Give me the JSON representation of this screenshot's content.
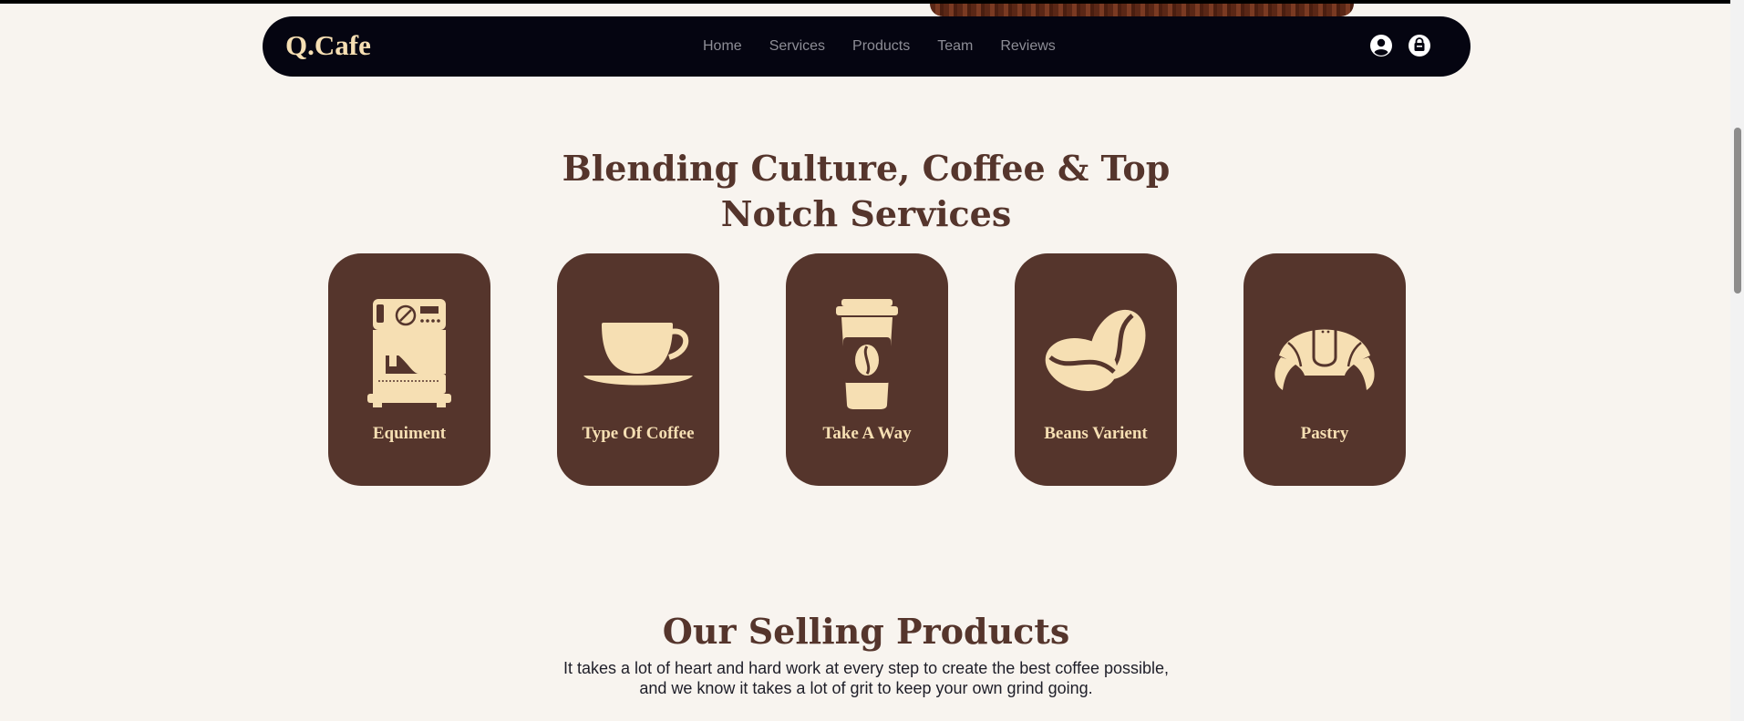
{
  "header": {
    "logo": "Q.Cafe",
    "nav": [
      "Home",
      "Services",
      "Products",
      "Team",
      "Reviews"
    ],
    "icons": [
      "user-icon",
      "shopping-bag-icon"
    ]
  },
  "services": {
    "title_line1": "Blending Culture, Coffee & Top",
    "title_line2": "Notch Services",
    "cards": [
      {
        "label": "Equiment",
        "icon": "espresso-machine-icon"
      },
      {
        "label": "Type Of Coffee",
        "icon": "coffee-cup-icon"
      },
      {
        "label": "Take A Way",
        "icon": "takeaway-cup-icon"
      },
      {
        "label": "Beans Varient",
        "icon": "coffee-beans-icon"
      },
      {
        "label": "Pastry",
        "icon": "croissant-icon"
      }
    ]
  },
  "products": {
    "title": "Our Selling Products",
    "desc_line1": "It takes a lot of heart and hard work at every step to create the best coffee possible,",
    "desc_line2": "and we know it takes a lot of grit to keep your own grind going."
  },
  "colors": {
    "background": "#f8f4ef",
    "nav_bg": "#050511",
    "brand_brown": "#55352c",
    "cream": "#f6dfb3"
  }
}
